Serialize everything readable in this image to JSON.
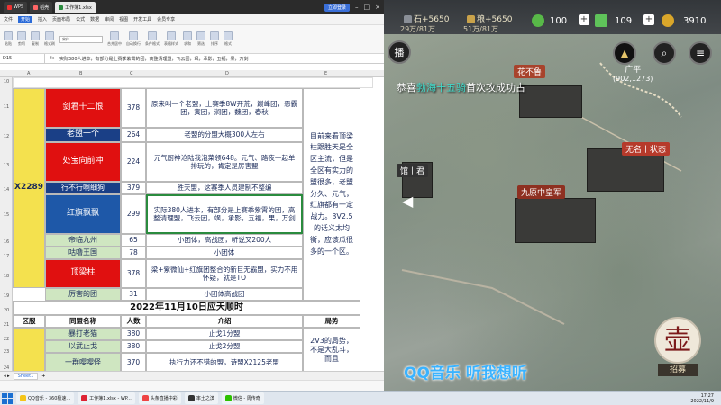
{
  "window": {
    "tabs": [
      "WPS",
      "稻壳",
      "工作簿1.xlsx"
    ],
    "login": "立即登录"
  },
  "menubar": [
    "文件",
    "开始",
    "插入",
    "页面布局",
    "公式",
    "数据",
    "审阅",
    "视图",
    "开发工具",
    "会员专享"
  ],
  "ribbon": {
    "font_name": "宋体",
    "items": [
      "粘贴",
      "剪切",
      "复制",
      "格式刷",
      "合并居中",
      "自动换行",
      "条件格式",
      "表格样式",
      "求和",
      "筛选",
      "排序",
      "格式"
    ]
  },
  "formula_bar": {
    "cell_ref": "D15",
    "fx": "fx",
    "content": "实际380人进本，有部分是上赛季紫霄的团，高整清理盟，飞云团，飒，承影，五福，果，万剑"
  },
  "columns": [
    "A",
    "B",
    "C",
    "D",
    "E"
  ],
  "rows": [
    "10",
    "11",
    "12",
    "13",
    "14",
    "15",
    "16",
    "17",
    "18",
    "19",
    "20",
    "21",
    "22",
    "23",
    "24"
  ],
  "sheet": {
    "zone": "X2289",
    "r11": {
      "name": "剑君十二恨",
      "count": "378",
      "desc": "原来叫一个老盟，上赛季8W开荒，巅峰团，恶霸团，寅团，涧团，魏团，春秋"
    },
    "r12": {
      "name": "老盟一个",
      "count": "264",
      "desc": "老盟的分盟大概300人左右"
    },
    "r13": {
      "name": "处宝向前冲",
      "count": "224",
      "desc": "元气厨神沧陆我泡菜领648。元气、路夜一起单排玩的，肯定是厉害盟"
    },
    "r14": {
      "name": "行不行啊细狗",
      "count": "379",
      "desc": "胜天盟，这赛季人员建制不整编"
    },
    "r15": {
      "name": "红旗飘飘",
      "count": "299",
      "desc": "实际380人进本，有部分是上赛季紫霄的团，高整清理盟，飞云团，飒，承影，五福，果，万剑"
    },
    "r16": {
      "name": "帝临九州",
      "count": "65",
      "desc": "小团体，高战团，听说又200人"
    },
    "r17": {
      "name": "咕噜王国",
      "count": "78",
      "desc": "小团体"
    },
    "r18": {
      "name": "顶梁柱",
      "count": "378",
      "desc": "梁+紫微仙+红旗团整合的新巨无霸盟，实力不用怀疑，就是TO"
    },
    "r19": {
      "name": "厉害的团",
      "count": "31",
      "desc": "小团体高战团"
    },
    "situation": "目前来看顶梁柱跟胜天是全区主流，但是全区有实力的盟很多，老盟分久、元气，红旗都有一定战力。3V2.5的话义太均衡，应该瓜很多的一个区。",
    "section_title": "2022年11月10日应天顺时",
    "headers": {
      "zone": "区服",
      "name": "同盟名称",
      "count": "人数",
      "desc": "介绍",
      "situation": "局势"
    },
    "r22": {
      "name": "暴打老猫",
      "count": "380",
      "desc": "止戈1分盟"
    },
    "r23": {
      "name": "以武止戈",
      "count": "380",
      "desc": "止戈2分盟"
    },
    "r24": {
      "name": "一群嘤嘤怪",
      "count": "370",
      "desc": "执行力还不错的盟，诗盟X2125老盟"
    },
    "situation2": "2V3的局势，不是大乱斗，而且"
  },
  "sheet_tab": "Sheet1",
  "game": {
    "res1": "石+5650",
    "res1_sub": "29万/81万",
    "res2": "粮+5650",
    "res2_sub": "51万/81万",
    "jade": "100",
    "copper": "109",
    "gold": "3910",
    "broadcast_prefix": "播",
    "banner_prefix": "恭喜",
    "banner_name": "勃海十五骑",
    "banner_suffix": "首次攻成功占",
    "city": "广平",
    "city_coord": "(902,1273)",
    "labels": [
      "花不鲁",
      "无名丨状态",
      "九原中皇军",
      "馆丨君"
    ],
    "qq": "QQ音乐 听我想听",
    "recruit_big": "壶",
    "recruit": "招募"
  },
  "taskbar": {
    "items": [
      "QQ音乐 - 360极速...",
      "工作簿1.xlsx - WP...",
      "头条直播中彩",
      "率土之滨",
      "微信 - 周传奇"
    ],
    "time": "17:27",
    "date": "2022/11/9"
  },
  "colors": {
    "red": "#e01010",
    "blue": "#1e58a8",
    "yellow": "#f4e14e",
    "green": "#cfe6c1"
  }
}
